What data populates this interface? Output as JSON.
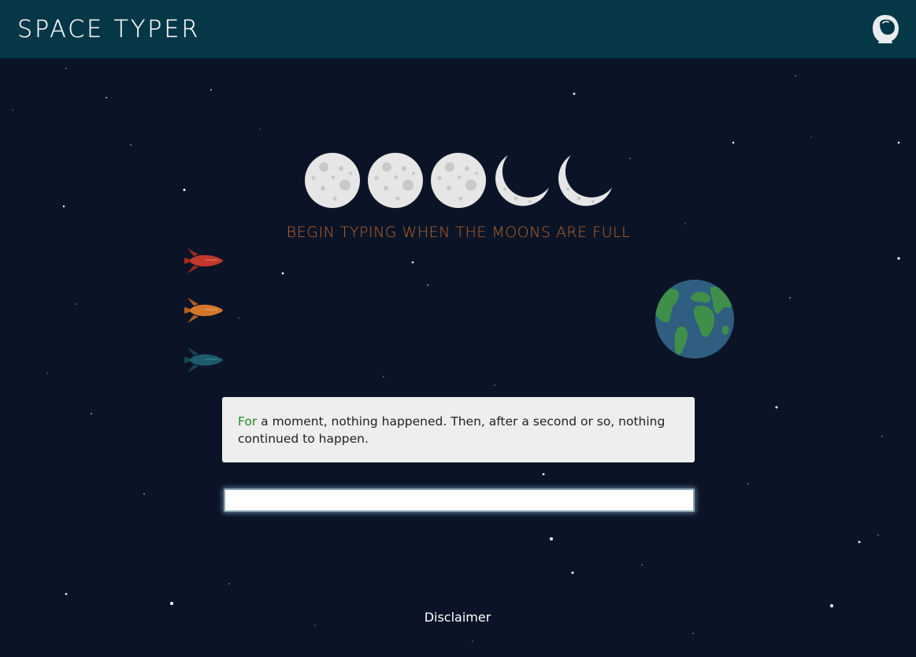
{
  "header": {
    "title": "SPACE TYPER",
    "profile_icon": "astronaut-helmet-icon",
    "background_color": "#063746"
  },
  "game": {
    "moons": [
      {
        "phase": "full"
      },
      {
        "phase": "full"
      },
      {
        "phase": "full"
      },
      {
        "phase": "crescent"
      },
      {
        "phase": "crescent"
      }
    ],
    "countdown_message": "BEGIN TYPING WHEN THE MOONS ARE FULL",
    "rockets": [
      {
        "name": "red-rocket",
        "color": "#c0392b"
      },
      {
        "name": "orange-rocket",
        "color": "#d4772a"
      },
      {
        "name": "teal-rocket",
        "color": "#1d5a6b"
      }
    ],
    "goal_icon": "earth-icon",
    "passage": {
      "typed": "For",
      "remaining": " a moment, nothing happened. Then, after a second or so, nothing continued to happen."
    },
    "input": {
      "value": "",
      "placeholder": ""
    }
  },
  "footer": {
    "disclaimer_label": "Disclaimer"
  },
  "colors": {
    "background": "#0b1427",
    "caption": "#b7612a",
    "typed_text": "#1f8f1f"
  }
}
